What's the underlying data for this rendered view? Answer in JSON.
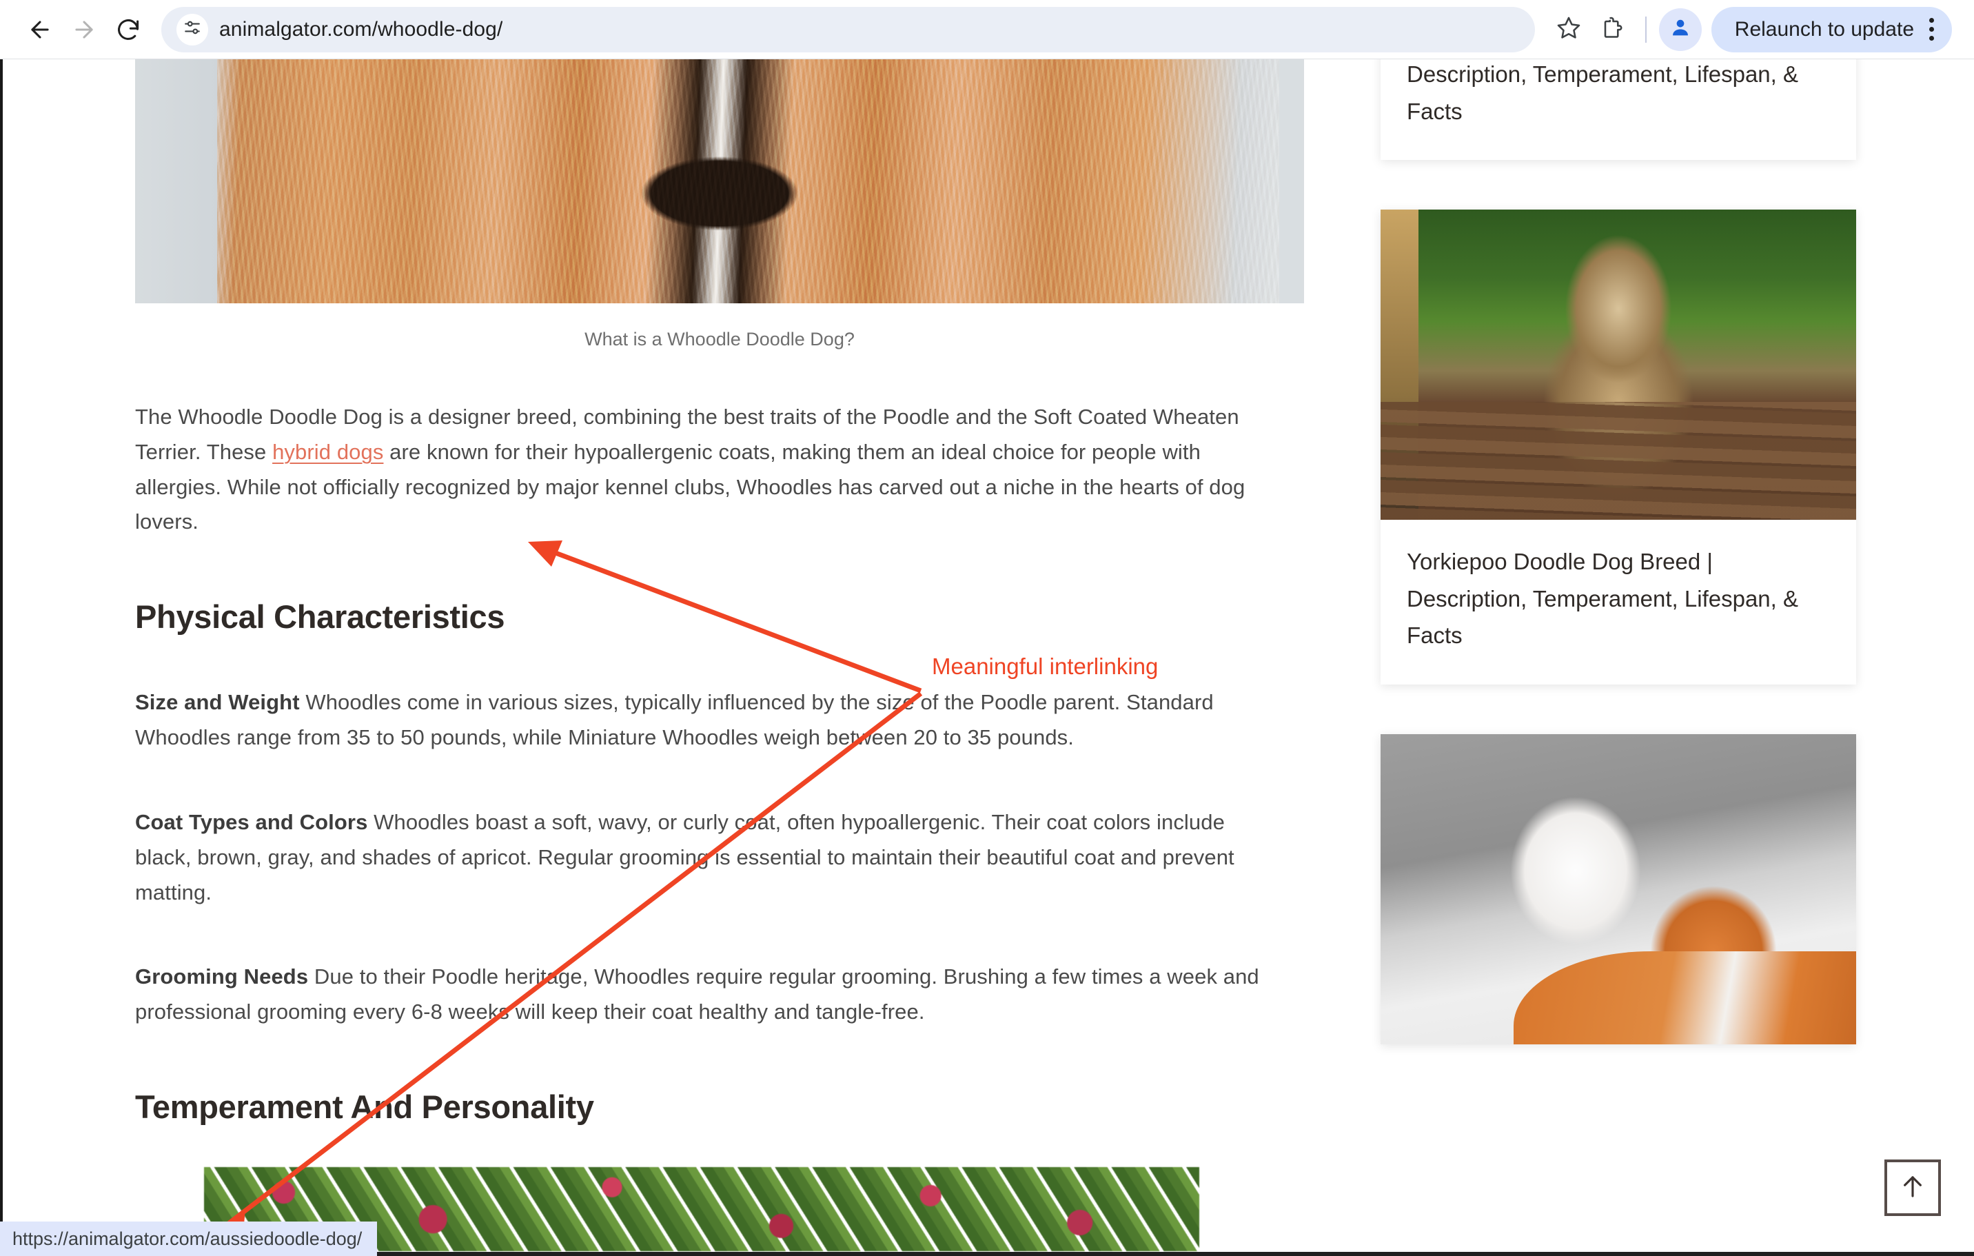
{
  "browser": {
    "back_icon": "arrow-left-icon",
    "forward_icon": "arrow-right-icon",
    "reload_icon": "reload-icon",
    "site_info_icon": "tune-settings-icon",
    "url": "animalgator.com/whoodle-dog/",
    "bookmark_icon": "star-icon",
    "extensions_icon": "puzzle-piece-icon",
    "profile_icon": "profile-avatar-icon",
    "relaunch_label": "Relaunch to update",
    "menu_icon": "kebab-menu-icon"
  },
  "article": {
    "hero_image_alt": "apricot whoodle dog lying on sand wearing a black and white bow tie",
    "caption": "What is a Whoodle Doodle Dog?",
    "intro": {
      "before_link": "The Whoodle Doodle Dog is a designer breed, combining the best traits of the Poodle and the Soft Coated Wheaten Terrier. These ",
      "link_text": "hybrid dogs",
      "after_link": " are known for their hypoallergenic coats, making them an ideal choice for people with allergies. While not officially recognized by major kennel clubs, Whoodles has carved out a niche in the hearts of dog lovers."
    },
    "heading_physical": "Physical Characteristics",
    "size_and_weight": {
      "label": "Size and Weight",
      "text": " Whoodles come in various sizes, typically influenced by the size of the Poodle parent. Standard Whoodles range from 35 to 50 pounds, while Miniature Whoodles weigh between 20 to 35 pounds."
    },
    "coat_types": {
      "label": "Coat Types and Colors",
      "text": " Whoodles boast a soft, wavy, or curly coat, often hypoallergenic. Their coat colors include black, brown, gray, and shades of apricot. Regular grooming is essential to maintain their beautiful coat and prevent matting."
    },
    "grooming_needs": {
      "label": "Grooming Needs",
      "text": " Due to their Poodle heritage, Whoodles require regular grooming. Brushing a few times a week and professional grooming every 6-8 weeks will keep their coat healthy and tangle-free."
    },
    "heading_temperament": "Temperament And Personality",
    "bottom_image_alt": "green and red foliage leaves"
  },
  "sidebar": {
    "cards": [
      {
        "title": "Shih-Poo Doodle Dog Breed | Description, Temperament, Lifespan, & Facts",
        "has_image": false
      },
      {
        "title": "Yorkiepoo Doodle Dog Breed | Description, Temperament, Lifespan, & Facts",
        "has_image": true,
        "image_alt": "yorkiepoo puppy sitting on a wooden deck with green hedge background"
      },
      {
        "title": "",
        "has_image": true,
        "image_alt": "white and gray terrier dog holding an orange plush fox toy"
      }
    ]
  },
  "annotation": {
    "label": "Meaningful interlinking",
    "color": "#ef4424"
  },
  "scroll_top": {
    "icon": "arrow-up-icon"
  },
  "status_bar": {
    "url": "https://animalgator.com/aussiedoodle-dog/"
  }
}
